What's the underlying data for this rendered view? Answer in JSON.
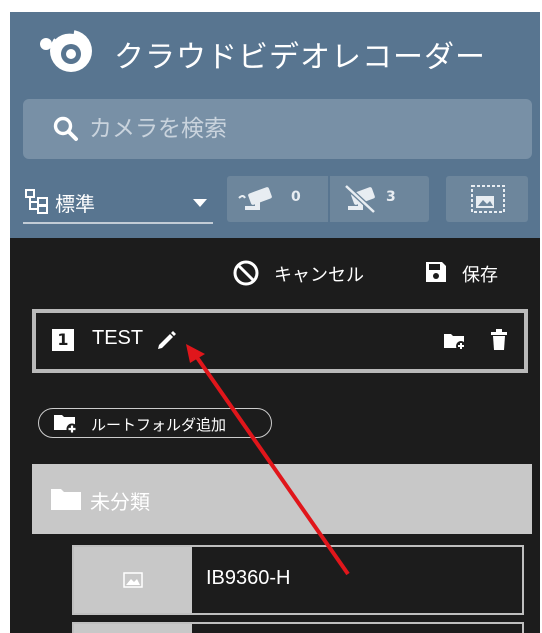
{
  "app": {
    "title": "クラウドビデオレコーダー",
    "logo_icon": "aupeo-style-a-logo"
  },
  "search": {
    "placeholder": "カメラを検索",
    "icon": "search-icon"
  },
  "layout_selector": {
    "icon": "layout-grid-icon",
    "selected": "標準"
  },
  "camera_filters": [
    {
      "icon": "camera-online-icon",
      "count": "0"
    },
    {
      "icon": "camera-offline-icon",
      "count": "3"
    }
  ],
  "screen_button": {
    "icon": "screen-image-icon"
  },
  "actions": {
    "cancel_label": "キャンセル",
    "save_label": "保存"
  },
  "layout_entry": {
    "number": "1",
    "name": "TEST"
  },
  "root_folder": {
    "add_label": "ルートフォルダ追加"
  },
  "folders": [
    {
      "name": "未分類"
    }
  ],
  "cameras": [
    {
      "name": "IB9360-H"
    }
  ],
  "colors": {
    "header_bg": "#587590",
    "panel_bg": "#1c1c1c",
    "folder_bg": "#c8c8c8",
    "annotation_arrow": "#e0161b"
  }
}
